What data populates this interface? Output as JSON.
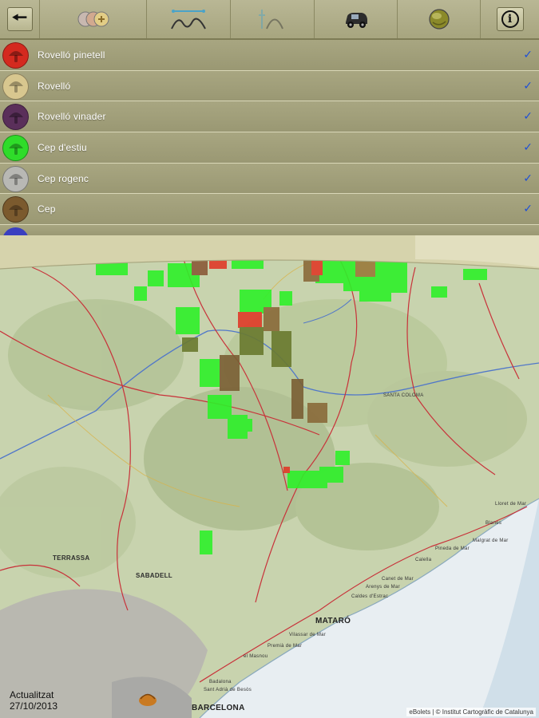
{
  "toolbar": {
    "back_icon": "arrow-left-icon",
    "info_label": "i",
    "icons": [
      "species-coins-icon",
      "terrain-profile-icon",
      "altitude-profile-icon",
      "vehicle-icon",
      "globe-layer-icon"
    ]
  },
  "species": [
    {
      "name": "Rovelló pinetell",
      "color": "#d42a1f",
      "checked": "✓"
    },
    {
      "name": "Rovelló",
      "color": "#d8c78f",
      "checked": "✓"
    },
    {
      "name": "Rovelló vinader",
      "color": "#5a2f5a",
      "checked": "✓"
    },
    {
      "name": "Cep d'estiu",
      "color": "#2fdc2a",
      "checked": "✓"
    },
    {
      "name": "Cep rogenc",
      "color": "#b8b8b4",
      "checked": "✓"
    },
    {
      "name": "Cep",
      "color": "#7b5a2e",
      "checked": "✓"
    },
    {
      "name": "",
      "color": "#3a3fc0",
      "checked": ""
    }
  ],
  "map": {
    "updated_label": "Actualitzat",
    "updated_date": "27/10/2013",
    "credits": "eBolets | © Institut Cartogràfic de Catalunya",
    "places": {
      "barcelona": "BARCELONA",
      "mataro": "MATARÓ",
      "sabadell": "SABADELL",
      "terrassa": "TERRASSA",
      "badalona": "Badalona",
      "st_adria": "Sant Adrià de Besòs",
      "vilassar": "Vilassar de Mar",
      "premia": "Premià de Mar",
      "masnou": "el Masnou",
      "arenys": "Arenys de Mar",
      "caldes": "Caldes d'Estrac",
      "canet": "Canet de Mar",
      "calella": "Calella",
      "pineda": "Pineda de Mar",
      "malgrat": "Malgrat de Mar",
      "blanes": "Blanes",
      "lloret": "Lloret de Mar",
      "st_coloma": "SANTA COLOMA"
    }
  }
}
